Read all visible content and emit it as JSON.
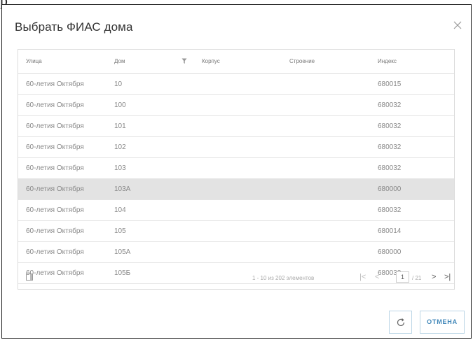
{
  "corner_text": "р",
  "dialog": {
    "title": "Выбрать ФИАС дома"
  },
  "grid": {
    "columns": [
      "Улица",
      "Дом",
      "Корпус",
      "Строение",
      "Индекс"
    ],
    "rows": [
      {
        "street": "60-летия Октября",
        "house": "10",
        "building": "",
        "structure": "",
        "index": "680015"
      },
      {
        "street": "60-летия Октября",
        "house": "100",
        "building": "",
        "structure": "",
        "index": "680032"
      },
      {
        "street": "60-летия Октября",
        "house": "101",
        "building": "",
        "structure": "",
        "index": "680032"
      },
      {
        "street": "60-летия Октября",
        "house": "102",
        "building": "",
        "structure": "",
        "index": "680032"
      },
      {
        "street": "60-летия Октября",
        "house": "103",
        "building": "",
        "structure": "",
        "index": "680032"
      },
      {
        "street": "60-летия Октября",
        "house": "103А",
        "building": "",
        "structure": "",
        "index": "680000",
        "selected": true
      },
      {
        "street": "60-летия Октября",
        "house": "104",
        "building": "",
        "structure": "",
        "index": "680032"
      },
      {
        "street": "60-летия Октября",
        "house": "105",
        "building": "",
        "structure": "",
        "index": "680014"
      },
      {
        "street": "60-летия Октября",
        "house": "105А",
        "building": "",
        "structure": "",
        "index": "680000"
      },
      {
        "street": "60-летия Октября",
        "house": "105Б",
        "building": "",
        "structure": "",
        "index": "680032"
      }
    ],
    "footer": {
      "summary": "1 - 10 из 202 элементов",
      "current_page": "1",
      "page_total": "/ 21",
      "first_label": "|<",
      "prev_label": "<",
      "next_label": ">",
      "last_label": ">|"
    }
  },
  "buttons": {
    "cancel_label": "ОТМЕНА"
  },
  "colors": {
    "accent": "#3f86b8",
    "selected_row": "#e3e3e3",
    "border": "#dcdcdc"
  },
  "icons": [
    "close-icon",
    "filter-icon",
    "columns-icon",
    "refresh-icon"
  ]
}
